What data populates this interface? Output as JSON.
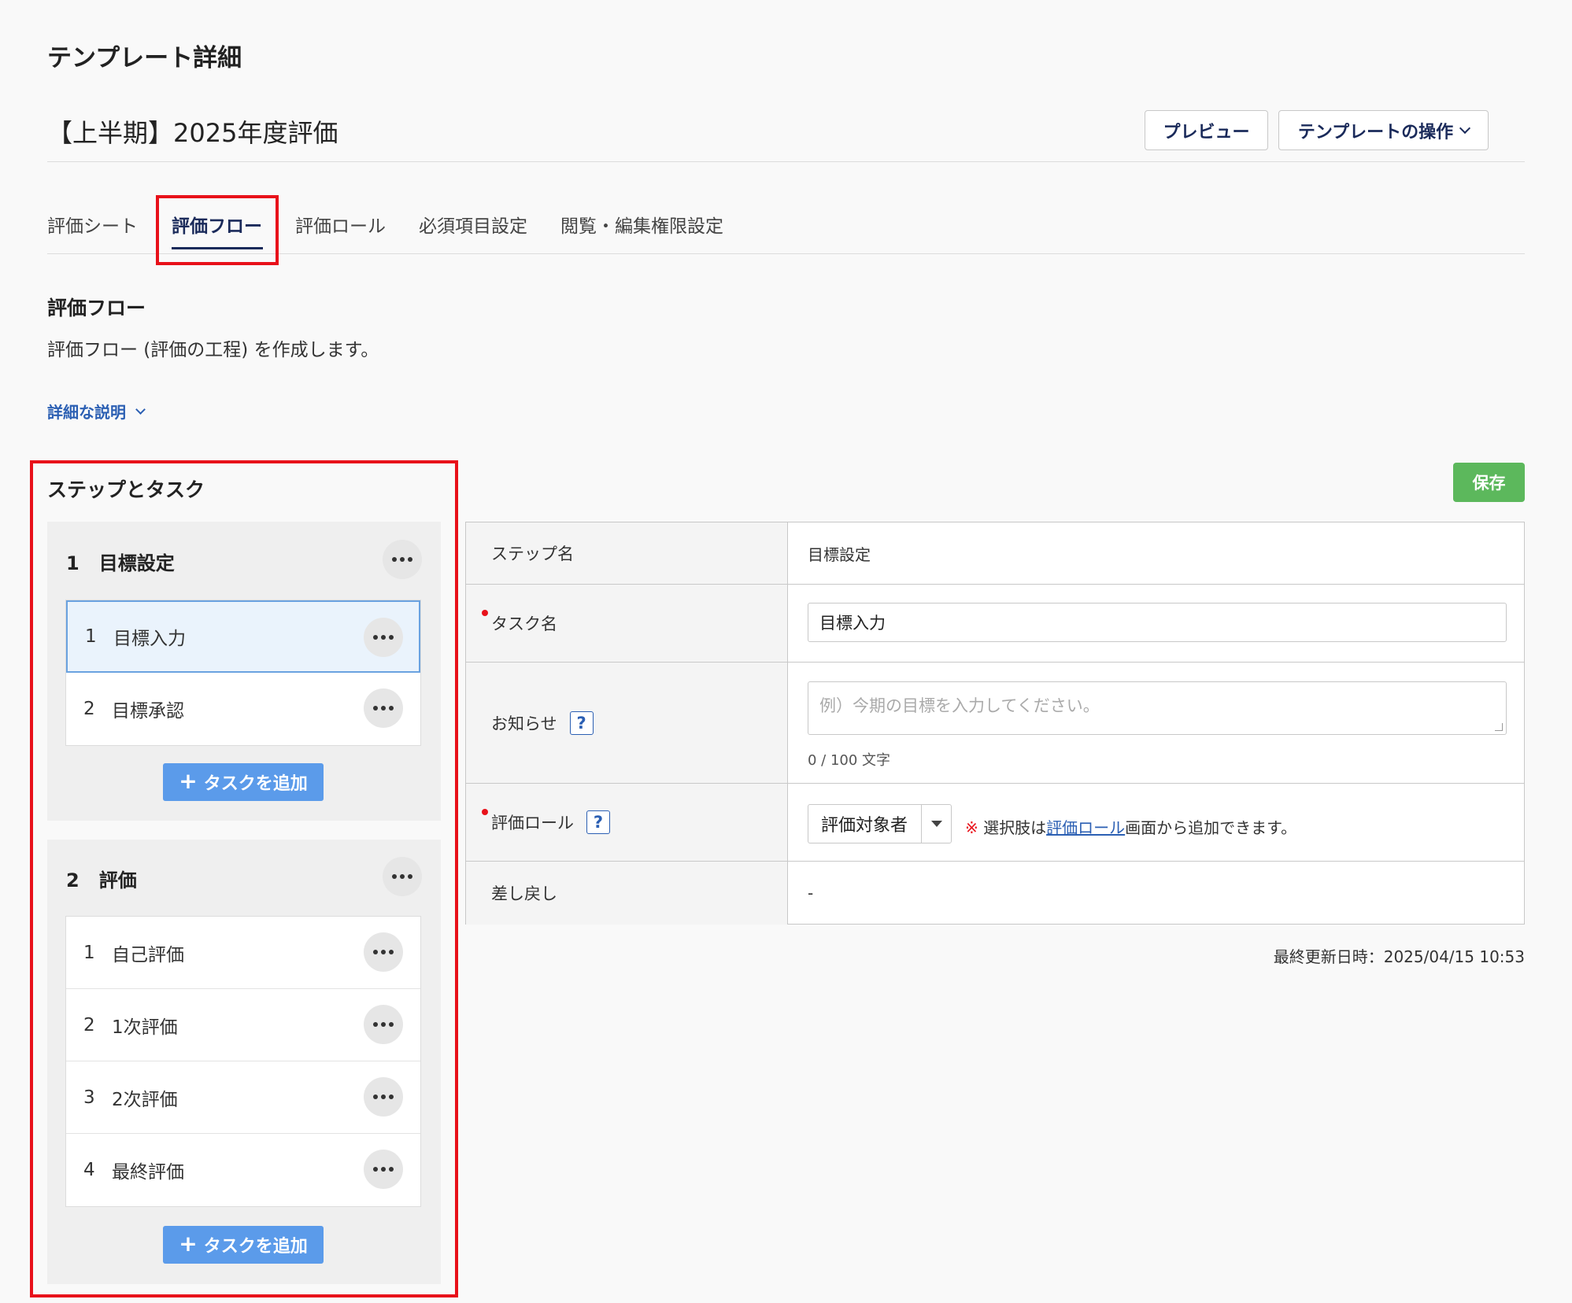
{
  "header": {
    "page_heading": "テンプレート詳細",
    "template_name": "【上半期】2025年度評価",
    "preview_label": "プレビュー",
    "ops_label": "テンプレートの操作"
  },
  "tabs": [
    {
      "label": "評価シート",
      "active": false
    },
    {
      "label": "評価フロー",
      "active": true
    },
    {
      "label": "評価ロール",
      "active": false
    },
    {
      "label": "必須項目設定",
      "active": false
    },
    {
      "label": "閲覧・編集権限設定",
      "active": false
    }
  ],
  "section": {
    "title": "評価フロー",
    "description": "評価フロー (評価の工程) を作成します。",
    "details_link": "詳細な説明"
  },
  "steps_panel": {
    "title": "ステップとタスク",
    "add_task_label": "タスクを追加",
    "steps": [
      {
        "num": "1",
        "name": "目標設定",
        "tasks": [
          {
            "num": "1",
            "name": "目標入力",
            "selected": true
          },
          {
            "num": "2",
            "name": "目標承認",
            "selected": false
          }
        ]
      },
      {
        "num": "2",
        "name": "評価",
        "tasks": [
          {
            "num": "1",
            "name": "自己評価",
            "selected": false
          },
          {
            "num": "2",
            "name": "1次評価",
            "selected": false
          },
          {
            "num": "3",
            "name": "2次評価",
            "selected": false
          },
          {
            "num": "4",
            "name": "最終評価",
            "selected": false
          }
        ]
      }
    ]
  },
  "save_label": "保存",
  "form": {
    "step_name_label": "ステップ名",
    "step_name_value": "目標設定",
    "task_name_label": "タスク名",
    "task_name_value": "目標入力",
    "notice_label": "お知らせ",
    "notice_placeholder": "例）今期の目標を入力してください。",
    "notice_counter": "0 / 100 文字",
    "role_label": "評価ロール",
    "role_value": "評価対象者",
    "role_note_mark": "※",
    "role_note_pre": " 選択肢は",
    "role_note_link": "評価ロール",
    "role_note_post": "画面から追加できます。",
    "sendback_label": "差し戻し",
    "sendback_value": "-",
    "help_glyph": "?"
  },
  "last_updated": "最終更新日時：2025/04/15 10:53",
  "colors": {
    "accent_navy": "#1a2a5a",
    "link_blue": "#2b5fb3",
    "add_button_blue": "#5b9bea",
    "save_green": "#5cb85c",
    "highlight_red": "#e8111a"
  }
}
